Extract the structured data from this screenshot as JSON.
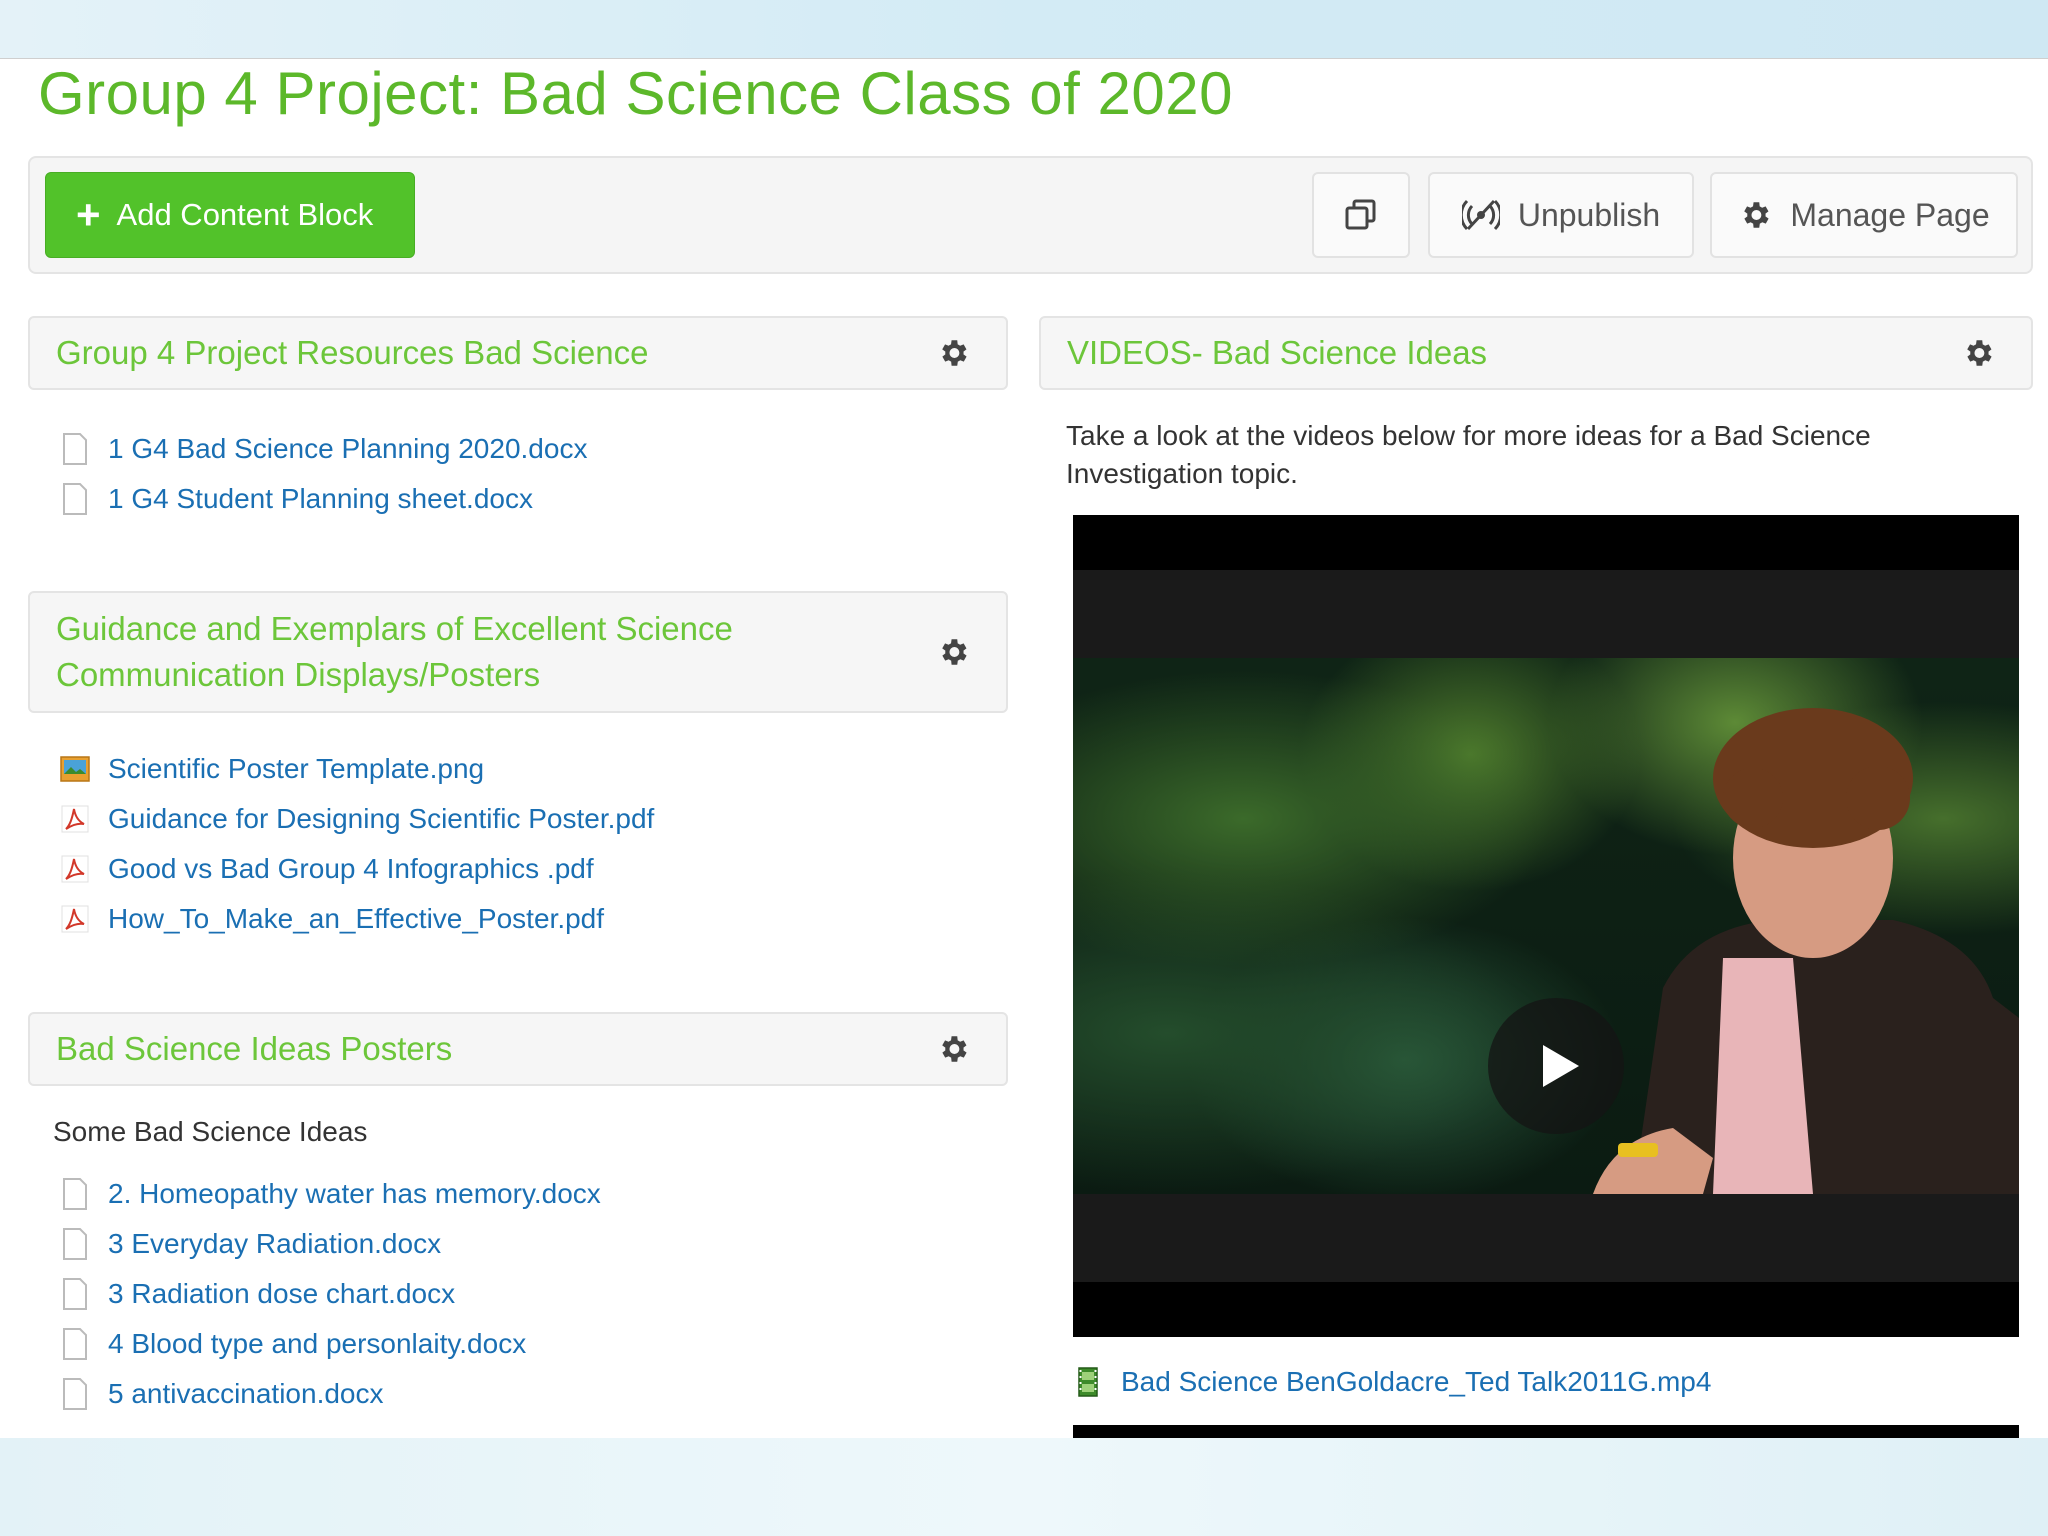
{
  "page": {
    "title": "Group 4 Project: Bad Science Class of 2020"
  },
  "toolbar": {
    "add_label": "Add Content Block",
    "unpublish_label": "Unpublish",
    "manage_label": "Manage Page",
    "accent_color": "#52c22a"
  },
  "blocks": {
    "resources": {
      "title": "Group 4 Project Resources Bad Science",
      "files": [
        {
          "name": "1 G4 Bad Science Planning 2020.docx",
          "icon": "document-icon"
        },
        {
          "name": "1 G4 Student Planning sheet.docx",
          "icon": "document-icon"
        }
      ]
    },
    "guidance": {
      "title_line1": "Guidance and Exemplars of Excellent Science",
      "title_line2": "Communication Displays/Posters",
      "files": [
        {
          "name": "Scientific Poster Template.png",
          "icon": "image-file-icon"
        },
        {
          "name": "Guidance for Designing Scientific Poster.pdf",
          "icon": "pdf-icon"
        },
        {
          "name": "Good vs Bad Group 4 Infographics .pdf",
          "icon": "pdf-icon"
        },
        {
          "name": "How_To_Make_an_Effective_Poster.pdf",
          "icon": "pdf-icon"
        }
      ]
    },
    "posters": {
      "title": "Bad Science Ideas Posters",
      "intro": "Some Bad Science Ideas",
      "files": [
        {
          "name": "2. Homeopathy water has memory.docx",
          "icon": "document-icon"
        },
        {
          "name": "3 Everyday Radiation.docx",
          "icon": "document-icon"
        },
        {
          "name": "3 Radiation dose chart.docx",
          "icon": "document-icon"
        },
        {
          "name": "4 Blood type and personlaity.docx",
          "icon": "document-icon"
        },
        {
          "name": "5 antivaccination.docx",
          "icon": "document-icon"
        }
      ]
    },
    "videos": {
      "title": "VIDEOS- Bad Science Ideas",
      "description": "Take a look at the videos below for more ideas for a Bad Science Investigation topic.",
      "video_file": "Bad Science BenGoldacre_Ted Talk2011G.mp4"
    }
  },
  "colors": {
    "heading_green": "#6cc63a",
    "link_blue": "#1a6fb3"
  }
}
